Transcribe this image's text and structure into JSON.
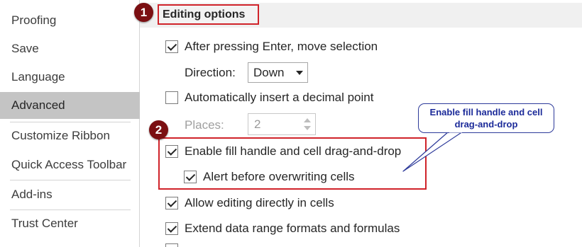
{
  "nav": {
    "items": [
      {
        "label": "Proofing",
        "selected": false
      },
      {
        "label": "Save",
        "selected": false
      },
      {
        "label": "Language",
        "selected": false
      },
      {
        "label": "Advanced",
        "selected": true
      },
      {
        "label": "Customize Ribbon",
        "selected": false
      },
      {
        "label": "Quick Access Toolbar",
        "selected": false
      },
      {
        "label": "Add-ins",
        "selected": false
      },
      {
        "label": "Trust Center",
        "selected": false
      }
    ]
  },
  "section": {
    "title": "Editing options",
    "badge1": "1",
    "badge2": "2"
  },
  "options": {
    "after_enter": {
      "label": "After pressing Enter, move selection",
      "checked": true
    },
    "direction": {
      "label": "Direction:",
      "value": "Down"
    },
    "auto_decimal": {
      "label": "Automatically insert a decimal point",
      "checked": false
    },
    "places": {
      "label": "Places:",
      "value": "2"
    },
    "fill_handle": {
      "label": "Enable fill handle and cell drag-and-drop",
      "checked": true
    },
    "alert_overwrite": {
      "label": "Alert before overwriting cells",
      "checked": true
    },
    "allow_editing": {
      "label": "Allow editing directly in cells",
      "checked": true
    },
    "extend_formats": {
      "label": "Extend data range formats and formulas",
      "checked": true
    }
  },
  "callout": {
    "text": "Enable fill handle and cell drag-and-drop"
  },
  "colors": {
    "highlight_red": "#d0232a",
    "badge": "#7b0f12",
    "callout_text": "#1b2a99",
    "selected_nav": "#c4c4c4"
  }
}
